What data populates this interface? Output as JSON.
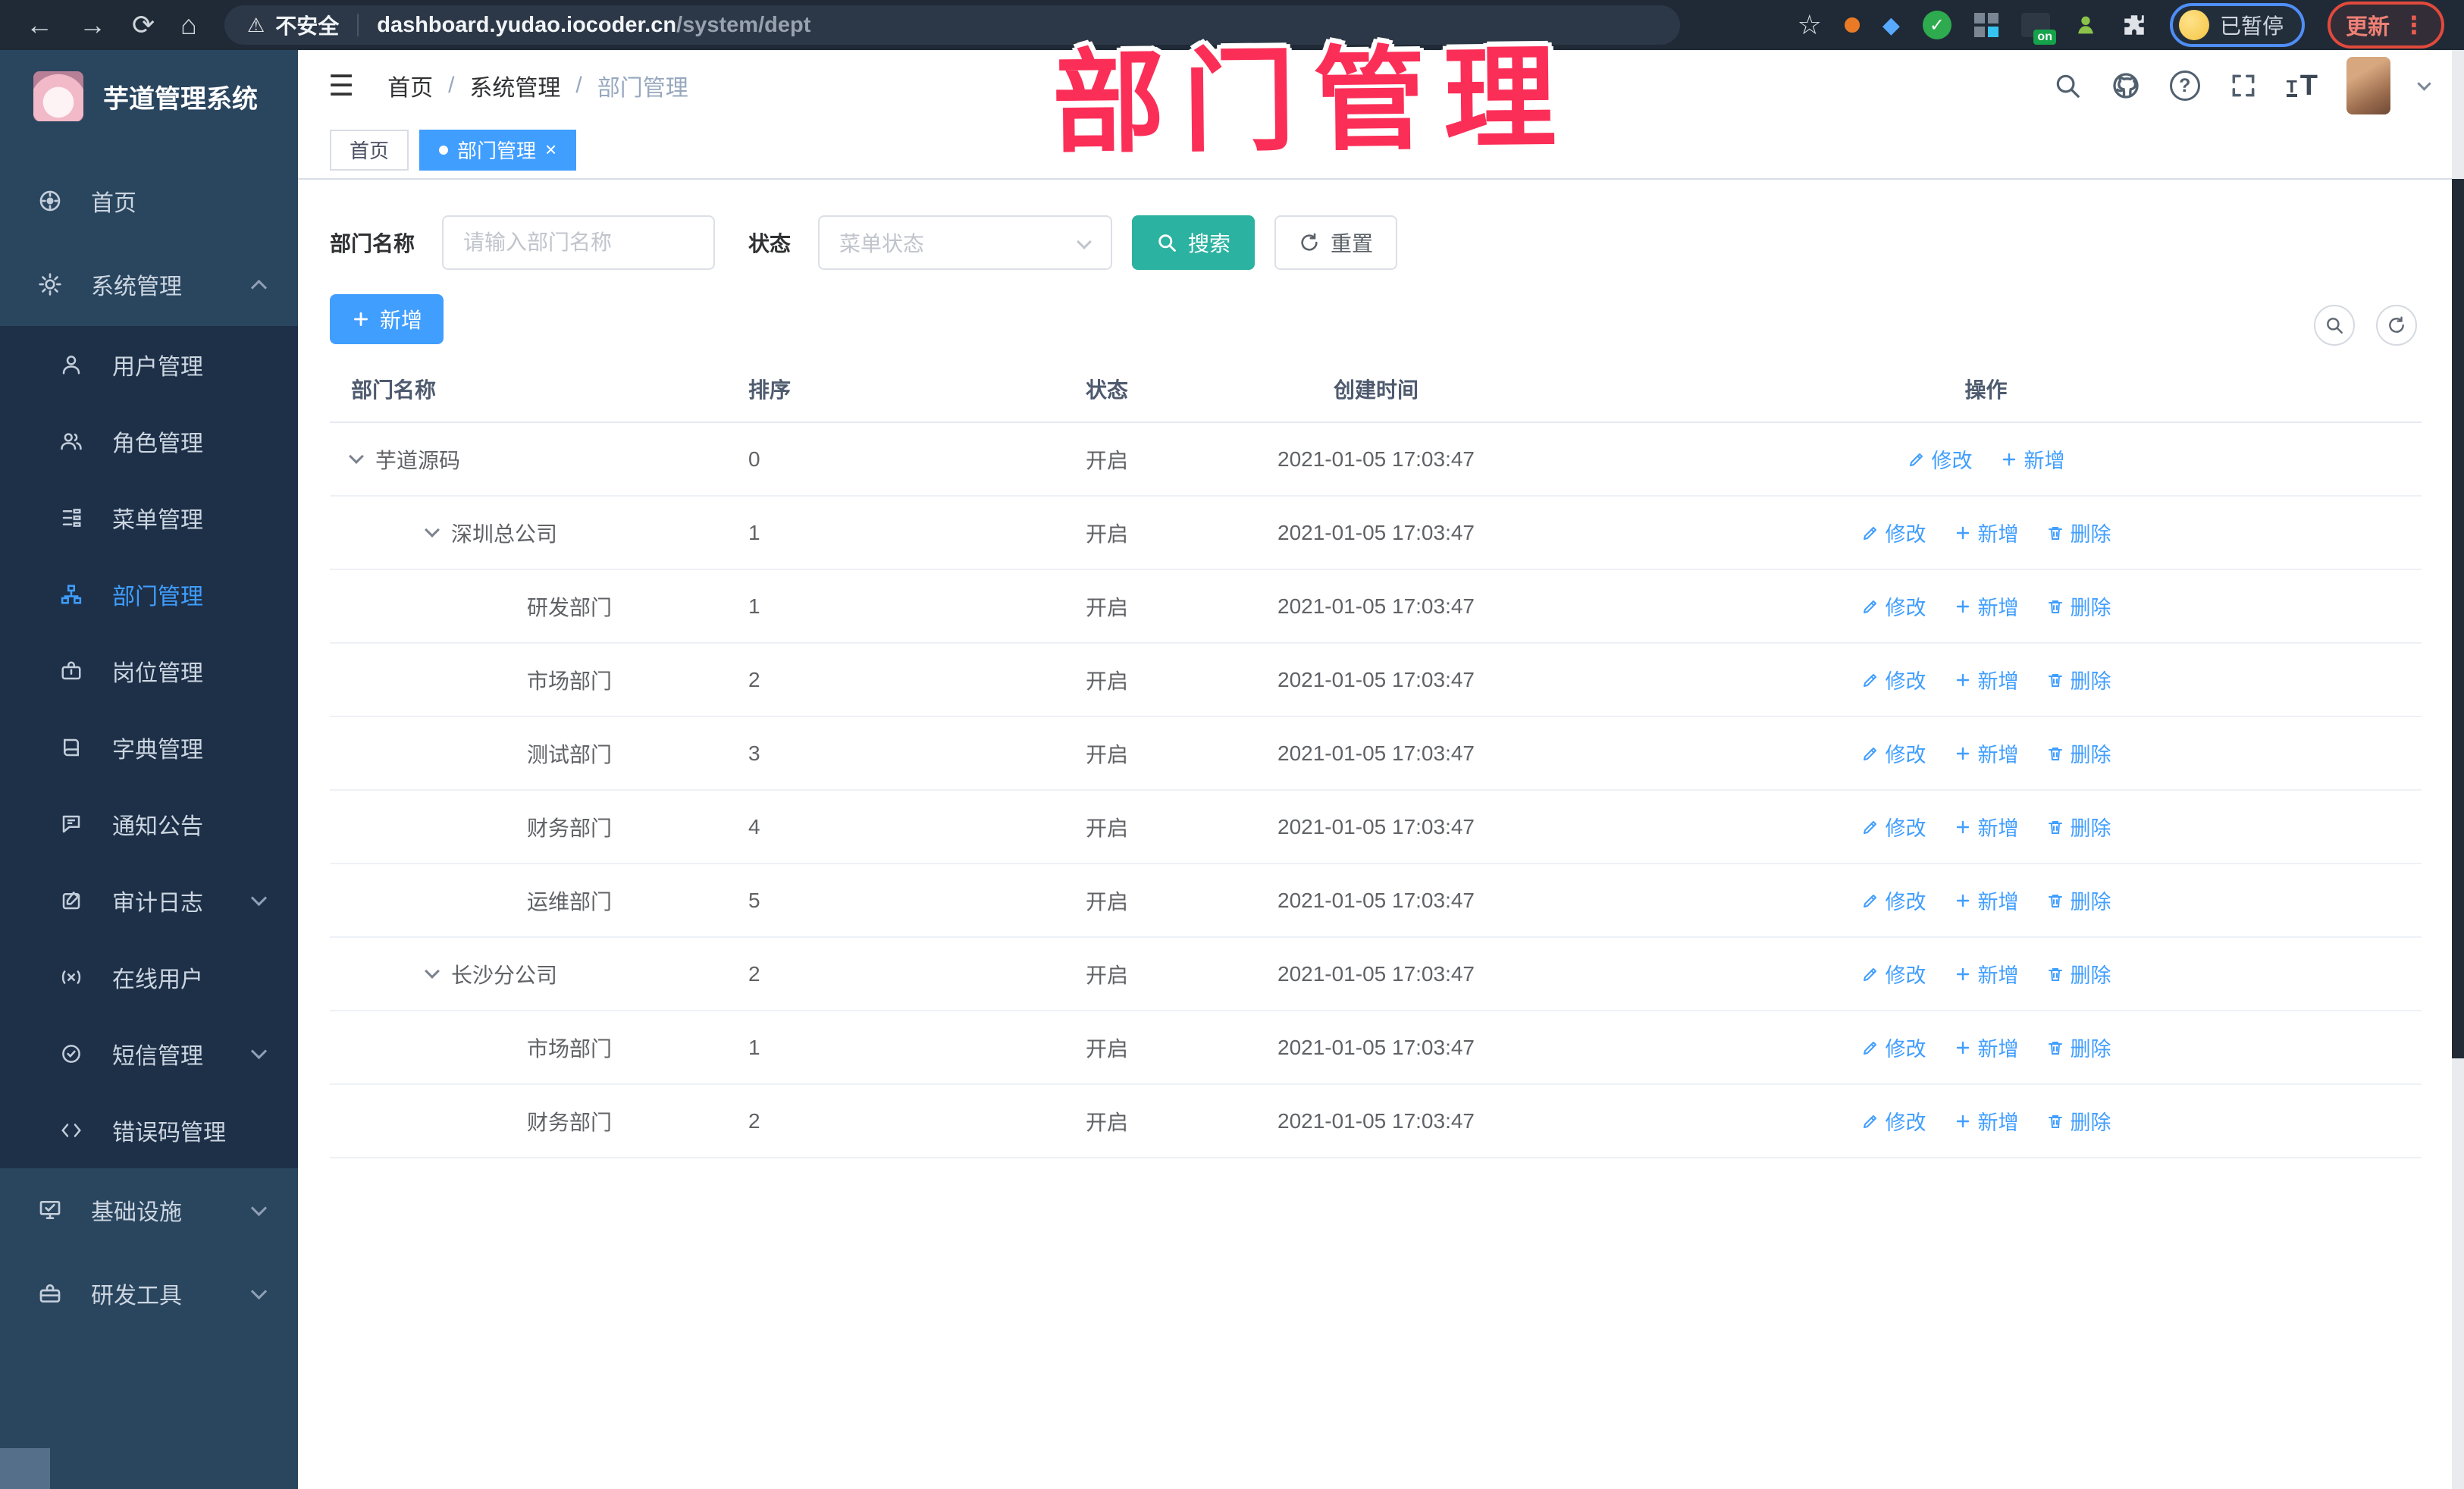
{
  "browser": {
    "security_label": "不安全",
    "url_host": "dashboard.yudao.iocoder.cn",
    "url_path": "/system/dept",
    "profile_status": "已暂停",
    "update_label": "更新"
  },
  "overlay_title": "部门管理",
  "sidebar": {
    "app_title": "芋道管理系统",
    "items": [
      {
        "label": "首页"
      },
      {
        "label": "系统管理"
      },
      {
        "label": "用户管理"
      },
      {
        "label": "角色管理"
      },
      {
        "label": "菜单管理"
      },
      {
        "label": "部门管理"
      },
      {
        "label": "岗位管理"
      },
      {
        "label": "字典管理"
      },
      {
        "label": "通知公告"
      },
      {
        "label": "审计日志"
      },
      {
        "label": "在线用户"
      },
      {
        "label": "短信管理"
      },
      {
        "label": "错误码管理"
      },
      {
        "label": "基础设施"
      },
      {
        "label": "研发工具"
      }
    ]
  },
  "header": {
    "breadcrumb": [
      "首页",
      "系统管理",
      "部门管理"
    ]
  },
  "tabs": [
    {
      "label": "首页"
    },
    {
      "label": "部门管理"
    }
  ],
  "filters": {
    "dept_name_label": "部门名称",
    "dept_name_placeholder": "请输入部门名称",
    "dept_name_value": "",
    "status_label": "状态",
    "status_placeholder": "菜单状态",
    "search_label": "搜索",
    "reset_label": "重置"
  },
  "toolbar": {
    "add_label": "新增"
  },
  "table": {
    "columns": [
      "部门名称",
      "排序",
      "状态",
      "创建时间",
      "操作"
    ],
    "rows": [
      {
        "name": "芋道源码",
        "level": 0,
        "expandable": true,
        "sort": "0",
        "status": "开启",
        "created": "2021-01-05 17:03:47",
        "actions": [
          {
            "key": "edit",
            "label": "修改"
          },
          {
            "key": "add",
            "label": "新增"
          }
        ]
      },
      {
        "name": "深圳总公司",
        "level": 1,
        "expandable": true,
        "sort": "1",
        "status": "开启",
        "created": "2021-01-05 17:03:47",
        "actions": [
          {
            "key": "edit",
            "label": "修改"
          },
          {
            "key": "add",
            "label": "新增"
          },
          {
            "key": "del",
            "label": "删除"
          }
        ]
      },
      {
        "name": "研发部门",
        "level": 2,
        "expandable": false,
        "sort": "1",
        "status": "开启",
        "created": "2021-01-05 17:03:47",
        "actions": [
          {
            "key": "edit",
            "label": "修改"
          },
          {
            "key": "add",
            "label": "新增"
          },
          {
            "key": "del",
            "label": "删除"
          }
        ]
      },
      {
        "name": "市场部门",
        "level": 2,
        "expandable": false,
        "sort": "2",
        "status": "开启",
        "created": "2021-01-05 17:03:47",
        "actions": [
          {
            "key": "edit",
            "label": "修改"
          },
          {
            "key": "add",
            "label": "新增"
          },
          {
            "key": "del",
            "label": "删除"
          }
        ]
      },
      {
        "name": "测试部门",
        "level": 2,
        "expandable": false,
        "sort": "3",
        "status": "开启",
        "created": "2021-01-05 17:03:47",
        "actions": [
          {
            "key": "edit",
            "label": "修改"
          },
          {
            "key": "add",
            "label": "新增"
          },
          {
            "key": "del",
            "label": "删除"
          }
        ]
      },
      {
        "name": "财务部门",
        "level": 2,
        "expandable": false,
        "sort": "4",
        "status": "开启",
        "created": "2021-01-05 17:03:47",
        "actions": [
          {
            "key": "edit",
            "label": "修改"
          },
          {
            "key": "add",
            "label": "新增"
          },
          {
            "key": "del",
            "label": "删除"
          }
        ]
      },
      {
        "name": "运维部门",
        "level": 2,
        "expandable": false,
        "sort": "5",
        "status": "开启",
        "created": "2021-01-05 17:03:47",
        "actions": [
          {
            "key": "edit",
            "label": "修改"
          },
          {
            "key": "add",
            "label": "新增"
          },
          {
            "key": "del",
            "label": "删除"
          }
        ]
      },
      {
        "name": "长沙分公司",
        "level": 1,
        "expandable": true,
        "sort": "2",
        "status": "开启",
        "created": "2021-01-05 17:03:47",
        "actions": [
          {
            "key": "edit",
            "label": "修改"
          },
          {
            "key": "add",
            "label": "新增"
          },
          {
            "key": "del",
            "label": "删除"
          }
        ]
      },
      {
        "name": "市场部门",
        "level": 2,
        "expandable": false,
        "sort": "1",
        "status": "开启",
        "created": "2021-01-05 17:03:47",
        "actions": [
          {
            "key": "edit",
            "label": "修改"
          },
          {
            "key": "add",
            "label": "新增"
          },
          {
            "key": "del",
            "label": "删除"
          }
        ]
      },
      {
        "name": "财务部门",
        "level": 2,
        "expandable": false,
        "sort": "2",
        "status": "开启",
        "created": "2021-01-05 17:03:47",
        "actions": [
          {
            "key": "edit",
            "label": "修改"
          },
          {
            "key": "add",
            "label": "新增"
          },
          {
            "key": "del",
            "label": "删除"
          }
        ]
      }
    ]
  },
  "colors": {
    "accent_blue": "#409EFF",
    "search_teal": "#2BB2A0",
    "overlay_pink": "#FB2E57",
    "sidebar_bg": "#2A455E",
    "submenu_bg": "#1E3048"
  }
}
